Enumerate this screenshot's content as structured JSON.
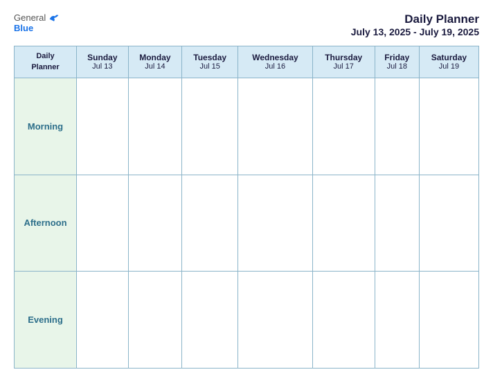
{
  "header": {
    "logo_general": "General",
    "logo_blue": "Blue",
    "main_title": "Daily Planner",
    "date_range": "July 13, 2025 - July 19, 2025"
  },
  "table": {
    "header_label_line1": "Daily",
    "header_label_line2": "Planner",
    "columns": [
      {
        "day": "Sunday",
        "date": "Jul 13"
      },
      {
        "day": "Monday",
        "date": "Jul 14"
      },
      {
        "day": "Tuesday",
        "date": "Jul 15"
      },
      {
        "day": "Wednesday",
        "date": "Jul 16"
      },
      {
        "day": "Thursday",
        "date": "Jul 17"
      },
      {
        "day": "Friday",
        "date": "Jul 18"
      },
      {
        "day": "Saturday",
        "date": "Jul 19"
      }
    ],
    "rows": [
      {
        "label": "Morning"
      },
      {
        "label": "Afternoon"
      },
      {
        "label": "Evening"
      }
    ]
  }
}
